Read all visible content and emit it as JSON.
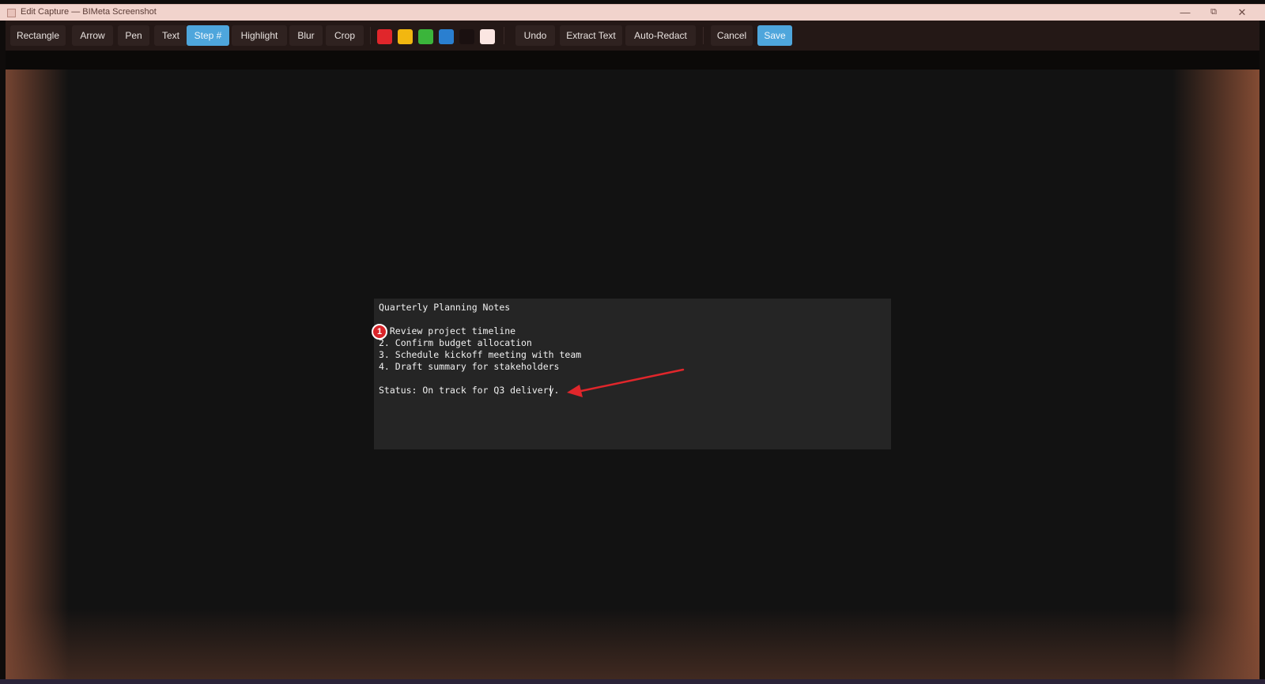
{
  "window": {
    "title": "Edit Capture — BIMeta Screenshot",
    "minimize_glyph": "—",
    "maximize_glyph": "⧉",
    "close_glyph": "✕"
  },
  "toolbar": {
    "tools": [
      "Rectangle",
      "Arrow",
      "Pen",
      "Text",
      "Step #",
      "Highlight",
      "Blur",
      "Crop"
    ],
    "active_tool": "Step #",
    "colors": [
      "#e0262b",
      "#f2b710",
      "#3bb53b",
      "#2a7fd0",
      "#1a1010",
      "#fbe6e2"
    ],
    "actions": [
      "Undo",
      "Extract Text",
      "Auto-Redact"
    ],
    "cancel_label": "Cancel",
    "save_label": "Save"
  },
  "capture": {
    "lines": [
      "Quarterly Planning Notes",
      "",
      "  Review project timeline",
      "2. Confirm budget allocation",
      "3. Schedule kickoff meeting with team",
      "4. Draft summary for stakeholders",
      "",
      "Status: On track for Q3 delivery."
    ],
    "step_badge_number": "1",
    "arrow_color": "#e0262b"
  }
}
